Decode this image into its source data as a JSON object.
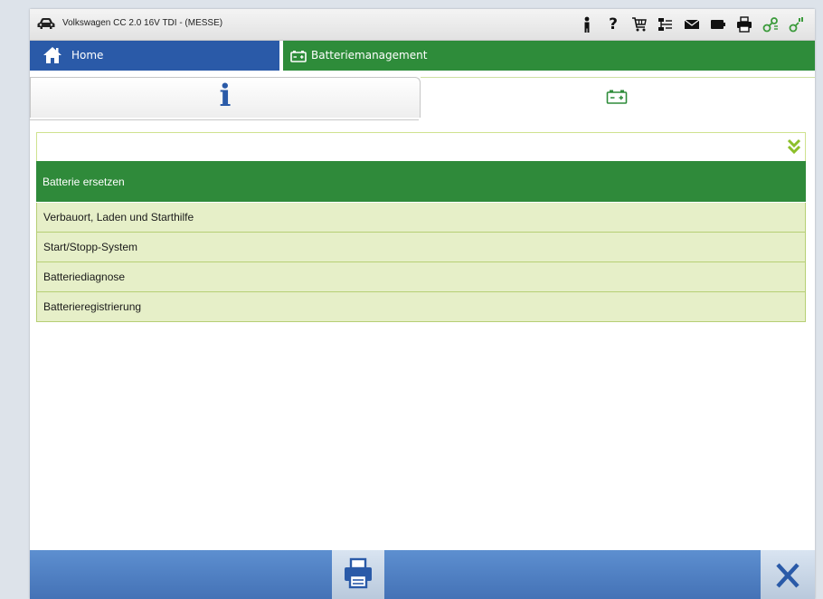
{
  "titlebar": {
    "vehicle_title": "Volkswagen CC 2.0 16V TDI - (MESSE)",
    "icons": [
      "car-icon",
      "person-icon",
      "help-icon",
      "cart-icon",
      "network-icon",
      "mail-icon",
      "battery-status-icon",
      "print-icon",
      "connection-icon",
      "signal-icon"
    ],
    "help_glyph": "?"
  },
  "nav": {
    "home_label": "Home",
    "current_label": "Batteriemanagement",
    "home_color": "#2a5aa8",
    "current_color": "#2e8c3a"
  },
  "tabs": [
    {
      "name": "info",
      "glyph": "i",
      "icon": "info-icon"
    },
    {
      "name": "battery",
      "icon": "battery-icon",
      "active": true
    }
  ],
  "dropdown": {
    "value": "",
    "icon": "chevron-double-down-icon"
  },
  "list": {
    "selected": "Batterie ersetzen",
    "items": [
      "Verbauort, Laden und Starthilfe",
      "Start/Stopp-System",
      "Batteriediagnose",
      "Batterieregistrierung"
    ]
  },
  "bottombar": {
    "print_icon": "printer-icon",
    "close_icon": "close-icon",
    "color": "#4f7fc2"
  }
}
